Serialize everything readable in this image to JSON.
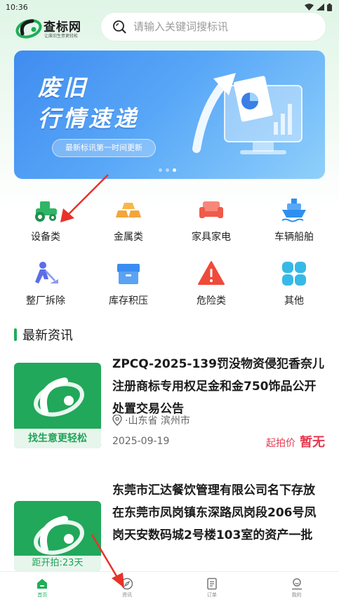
{
  "status_bar": {
    "time": "10:36"
  },
  "header": {
    "logo_title": "查标网",
    "logo_slogan": "让废旧生意更轻松",
    "search_placeholder": "请输入关键词搜标讯"
  },
  "banner": {
    "title_line1": "废旧",
    "title_line2": "行情速递",
    "pill_text": "最新标讯第一时间更新",
    "dot_count": 3,
    "active_dot": 3
  },
  "categories": [
    {
      "label": "设备类",
      "icon": "tractor-icon",
      "color": "#2fb566"
    },
    {
      "label": "金属类",
      "icon": "gold-bars-icon",
      "color": "#f4a53a"
    },
    {
      "label": "家具家电",
      "icon": "sofa-icon",
      "color": "#f05a4a"
    },
    {
      "label": "车辆船舶",
      "icon": "ship-icon",
      "color": "#2e8ff0"
    },
    {
      "label": "整厂拆除",
      "icon": "worker-icon",
      "color": "#5b6ee8"
    },
    {
      "label": "库存积压",
      "icon": "box-icon",
      "color": "#3a8df0"
    },
    {
      "label": "危险类",
      "icon": "warning-icon",
      "color": "#ef4a3a"
    },
    {
      "label": "其他",
      "icon": "grid-icon",
      "color": "#37b9e6"
    }
  ],
  "news_section": {
    "title": "最新资讯"
  },
  "news": [
    {
      "title": "ZPCQ-2025-139罚没物资侵犯香奈儿注册商标专用权足金和金750饰品公开处置交易公告",
      "thumb_caption": "找生意更轻松",
      "location": "·山东省 滨州市",
      "date": "2025-09-19",
      "price_label": "起拍价",
      "price_value": "暂无"
    },
    {
      "title": "东莞市汇达餐饮管理有限公司名下存放在东莞市凤岗镇东深路凤岗段206号凤岗天安数码城2号楼103室的资产一批",
      "thumb_caption": "距开拍:23天"
    }
  ],
  "tabbar": [
    {
      "label": "首页",
      "icon": "home-icon",
      "active": true
    },
    {
      "label": "资讯",
      "icon": "compass-icon",
      "active": false
    },
    {
      "label": "订单",
      "icon": "document-icon",
      "active": false
    },
    {
      "label": "我的",
      "icon": "profile-icon",
      "active": false
    }
  ],
  "colors": {
    "brand_green": "#1fae58",
    "price_red": "#e53950",
    "banner_blue": "#4a96f2"
  }
}
